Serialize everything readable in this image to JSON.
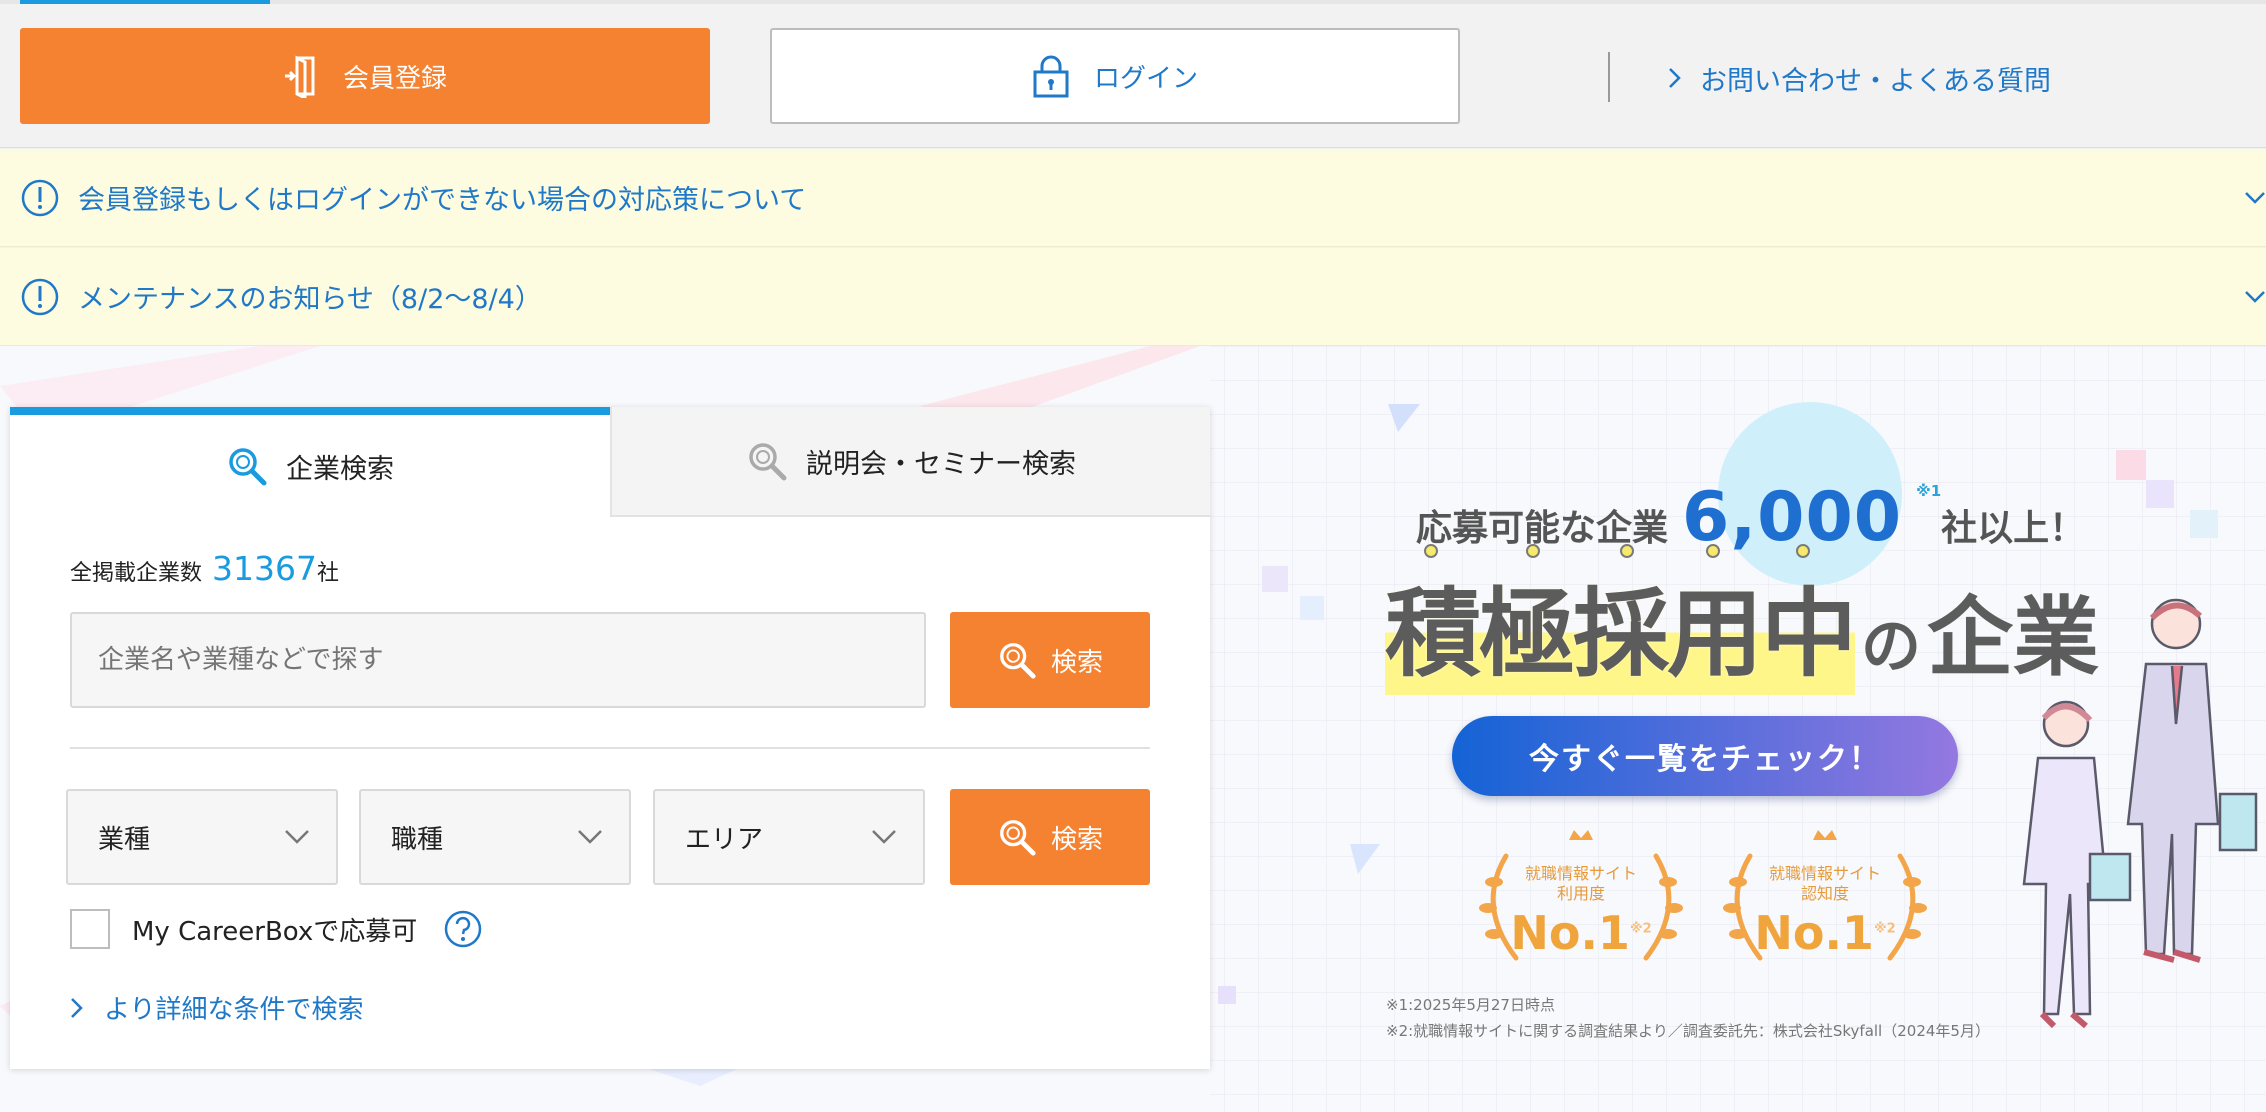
{
  "header": {
    "register_label": "会員登録",
    "login_label": "ログイン",
    "contact_link": "お問い合わせ・よくある質問"
  },
  "notices": [
    {
      "text": "会員登録もしくはログインができない場合の対応策について"
    },
    {
      "text": "メンテナンスのお知らせ（8/2〜8/4）"
    }
  ],
  "search": {
    "tabs": [
      {
        "label": "企業検索",
        "active": true
      },
      {
        "label": "説明会・セミナー検索",
        "active": false
      }
    ],
    "count_label": "全掲載企業数",
    "count_value": "31367",
    "count_unit": "社",
    "keyword_placeholder": "企業名や業種などで探す",
    "search_button": "検索",
    "filters": [
      {
        "label": "業種"
      },
      {
        "label": "職種"
      },
      {
        "label": "エリア"
      }
    ],
    "filter_search_button": "検索",
    "checkbox_label": "My CareerBoxで応募可",
    "detail_link": "より詳細な条件で検索"
  },
  "banner": {
    "line1_prefix": "応募可能な企業",
    "line1_number": "6,000",
    "line1_sup": "※1",
    "line1_suffix": "社以上！",
    "title_emphasis": "積極採用中",
    "title_particle": "の",
    "title_tail": "企業",
    "cta": "今すぐ一覧をチェック！",
    "badges": [
      {
        "label_line1": "就職情報サイト",
        "label_line2": "利用度",
        "value": "No.1",
        "note": "※2"
      },
      {
        "label_line1": "就職情報サイト",
        "label_line2": "認知度",
        "value": "No.1",
        "note": "※2"
      }
    ],
    "footnote1": "※1:2025年5月27日時点",
    "footnote2": "※2:就職情報サイトに関する調査結果より／調査委託先：株式会社Skyfall（2024年5月）"
  },
  "colors": {
    "accent_orange": "#f58231",
    "link_blue": "#1f78c8",
    "tab_blue": "#1a9be0",
    "notice_bg": "#fefce0"
  }
}
